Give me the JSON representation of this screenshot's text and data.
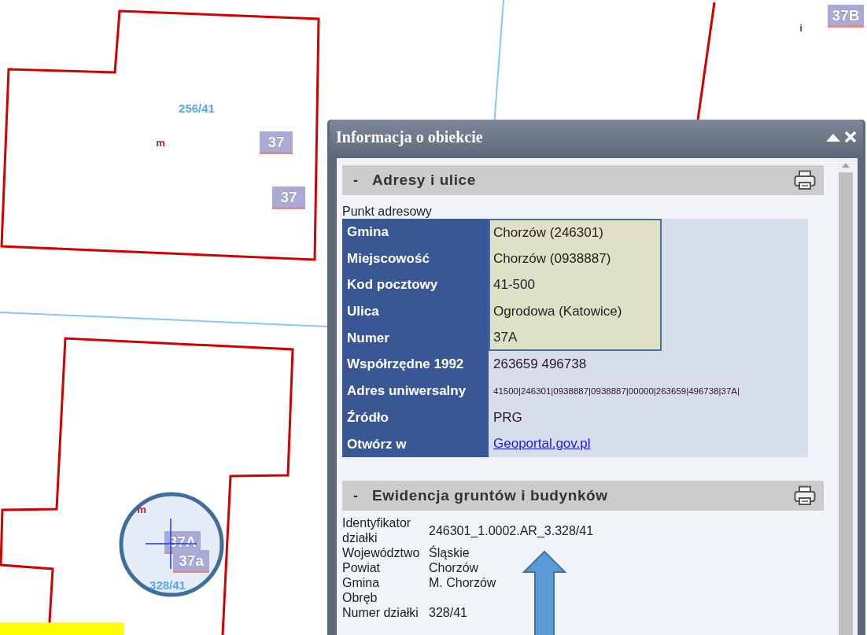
{
  "map": {
    "labels": [
      {
        "kind": "parcel",
        "text": "256/41"
      },
      {
        "kind": "usage",
        "text": "m"
      },
      {
        "kind": "house",
        "text": "37"
      },
      {
        "kind": "house",
        "text": "37"
      },
      {
        "kind": "usage",
        "text": "i"
      },
      {
        "kind": "house",
        "text": "37B"
      },
      {
        "kind": "usage",
        "text": "m"
      },
      {
        "kind": "house",
        "text": "37A"
      },
      {
        "kind": "house",
        "text": "37a"
      },
      {
        "kind": "parcel",
        "text": "328/41"
      }
    ]
  },
  "panel": {
    "title": "Informacja o obiekcie",
    "sections": [
      {
        "toggle": "-",
        "title": "Adresy i ulice",
        "subtitle": "Punkt adresowy",
        "rows": [
          {
            "label": "Gmina",
            "value": "Chorzów (246301)",
            "kind": "text",
            "highlighted": true
          },
          {
            "label": "Miejscowość",
            "value": "Chorzów (0938887)",
            "kind": "text",
            "highlighted": true
          },
          {
            "label": "Kod pocztowy",
            "value": "41-500",
            "kind": "text",
            "highlighted": true
          },
          {
            "label": "Ulica",
            "value": "Ogrodowa (Katowice)",
            "kind": "text",
            "highlighted": true
          },
          {
            "label": "Numer",
            "value": "37A",
            "kind": "text",
            "highlighted": true
          },
          {
            "label": "Współrzędne 1992",
            "value": "263659 496738",
            "kind": "text",
            "highlighted": false
          },
          {
            "label": "Adres uniwersalny",
            "value": "41500|246301|0938887|0938887|00000|263659|496738|37A|",
            "kind": "code",
            "highlighted": false
          },
          {
            "label": "Źródło",
            "value": "PRG",
            "kind": "text",
            "highlighted": false
          },
          {
            "label": "Otwórz w",
            "value": "Geoportal.gov.pl",
            "kind": "link",
            "highlighted": false
          }
        ]
      },
      {
        "toggle": "-",
        "title": "Ewidencja gruntów i budynków",
        "rows": [
          {
            "label": "Identyfikator działki",
            "value": "246301_1.0002.AR_3.328/41"
          },
          {
            "label": "Województwo",
            "value": "Śląskie"
          },
          {
            "label": "Powiat",
            "value": "Chorzów"
          },
          {
            "label": "Gmina",
            "value": "M. Chorzów"
          },
          {
            "label": "Obręb"
          },
          {
            "label": "Numer działki",
            "value": "328/41"
          }
        ]
      }
    ]
  }
}
